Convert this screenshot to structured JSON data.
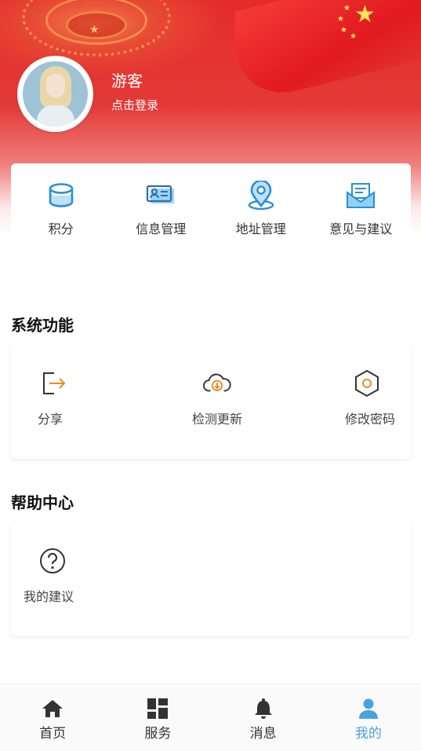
{
  "profile": {
    "name": "游客",
    "subtitle": "点击登录"
  },
  "quick_actions": [
    {
      "label": "积分",
      "icon": "coins-stack-icon"
    },
    {
      "label": "信息管理",
      "icon": "id-card-icon"
    },
    {
      "label": "地址管理",
      "icon": "location-pin-icon"
    },
    {
      "label": "意见与建议",
      "icon": "envelope-icon"
    }
  ],
  "system": {
    "title": "系统功能",
    "items": [
      {
        "label": "分享",
        "icon": "share-exit-icon"
      },
      {
        "label": "检测更新",
        "icon": "cloud-download-icon"
      },
      {
        "label": "修改密码",
        "icon": "hexagon-settings-icon"
      }
    ]
  },
  "help": {
    "title": "帮助中心",
    "items": [
      {
        "label": "我的建议",
        "icon": "question-circle-icon"
      }
    ]
  },
  "tabbar": [
    {
      "label": "首页",
      "icon": "home-icon",
      "active": false
    },
    {
      "label": "服务",
      "icon": "grid-icon",
      "active": false
    },
    {
      "label": "消息",
      "icon": "bell-icon",
      "active": false
    },
    {
      "label": "我的",
      "icon": "user-icon",
      "active": true
    }
  ],
  "colors": {
    "accent_blue": "#4aa3dc",
    "icon_orange": "#f08a24",
    "banner_red": "#e42c2a"
  }
}
